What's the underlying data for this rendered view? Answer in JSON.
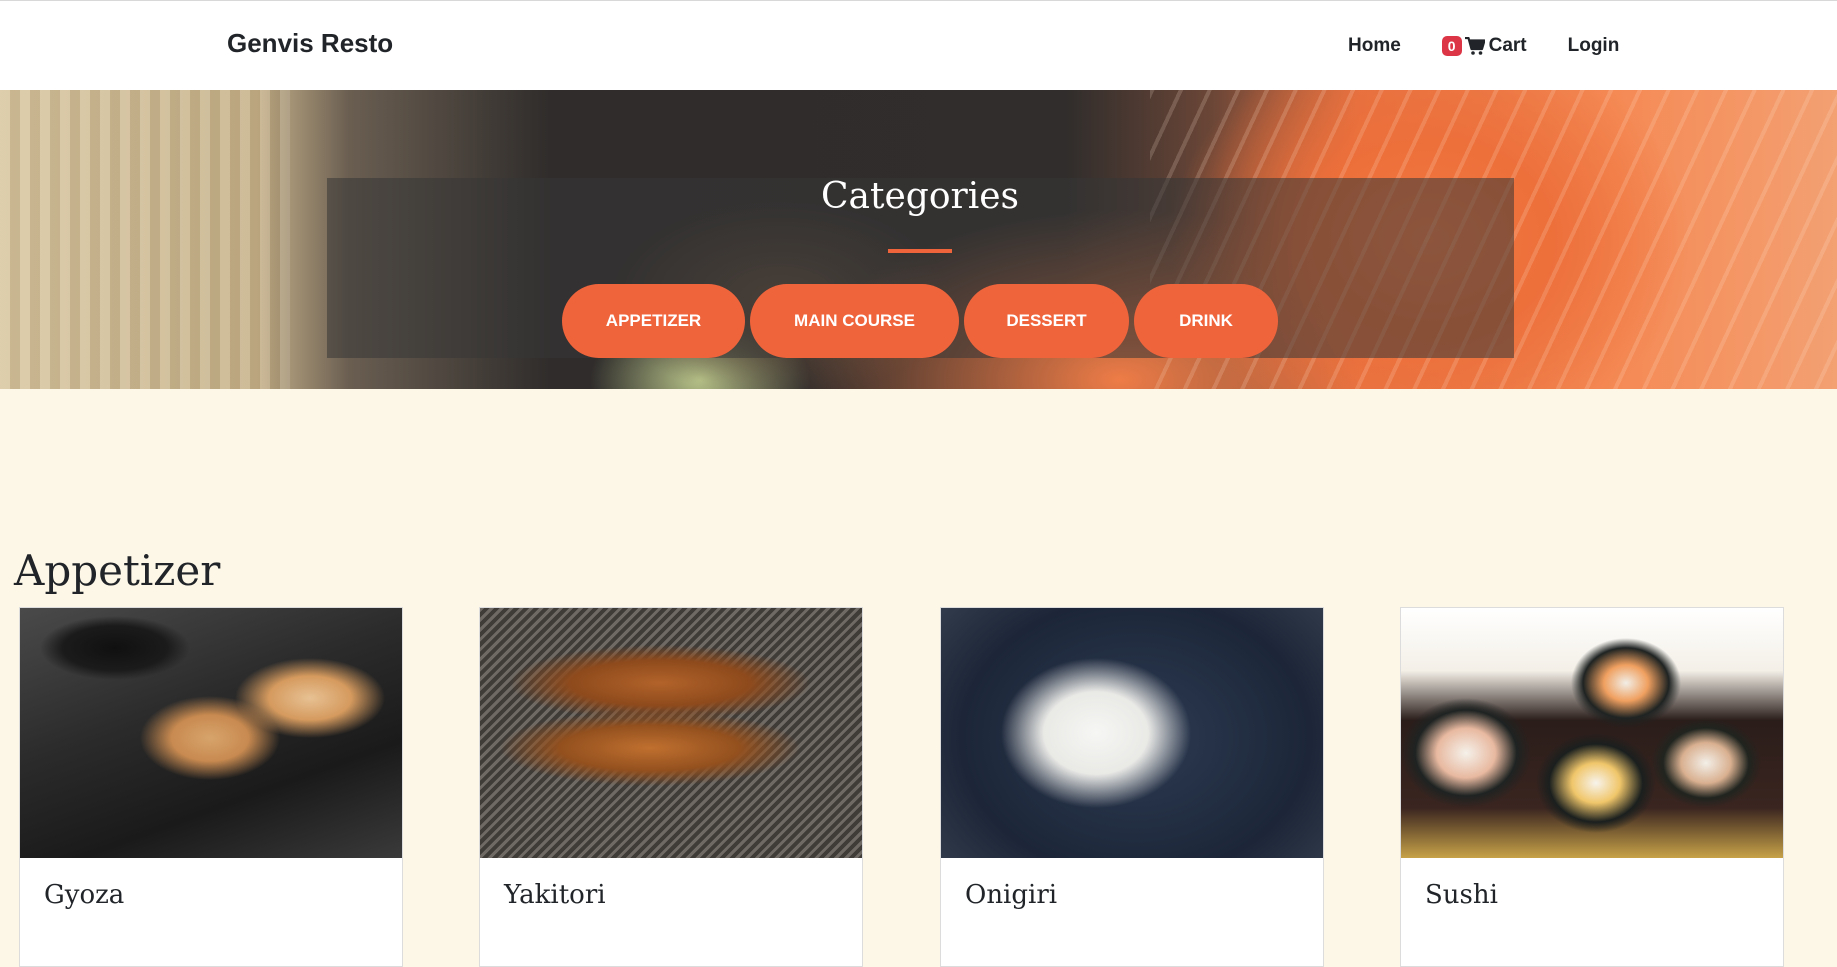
{
  "navbar": {
    "brand": "Genvis Resto",
    "links": {
      "home": "Home",
      "cart_count": "0",
      "cart": "Cart",
      "login": "Login"
    }
  },
  "hero": {
    "title": "Categories",
    "categories": [
      "APPETIZER",
      "MAIN COURSE",
      "DESSERT",
      "DRINK"
    ]
  },
  "menu": {
    "section_title": "Appetizer",
    "items": [
      {
        "name": "Gyoza"
      },
      {
        "name": "Yakitori"
      },
      {
        "name": "Onigiri"
      },
      {
        "name": "Sushi"
      }
    ]
  },
  "colors": {
    "accent": "#f0643c",
    "badge": "#dc3545",
    "page_background": "#fdf7e7"
  },
  "icons": {
    "cart": "shopping-cart-icon"
  }
}
